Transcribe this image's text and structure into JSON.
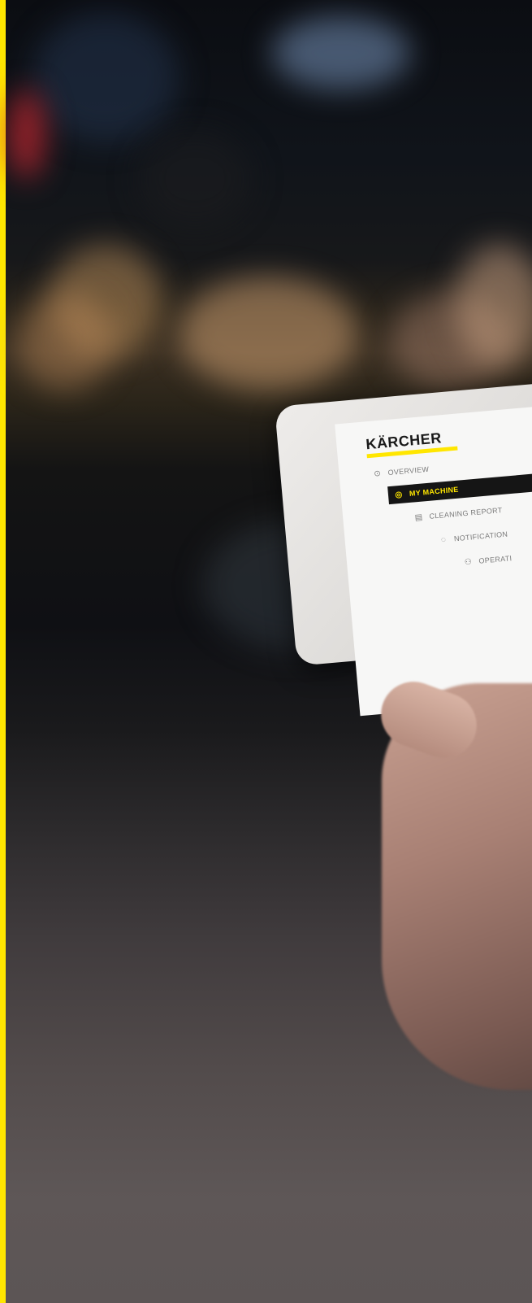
{
  "brand": {
    "logo_text": "KÄRCHER",
    "accent_color": "#ffe600"
  },
  "tablet_screen": {
    "nav": [
      {
        "label": "OVERVIEW",
        "icon": "overview-icon",
        "active": false
      },
      {
        "label": "MY MACHINE",
        "icon": "machine-icon",
        "active": true
      },
      {
        "label": "CLEANING REPORT",
        "icon": "report-icon",
        "active": false
      },
      {
        "label": "NOTIFICATION",
        "icon": "notification-icon",
        "active": false
      },
      {
        "label": "OPERATI",
        "icon": "operator-icon",
        "active": false
      }
    ]
  }
}
